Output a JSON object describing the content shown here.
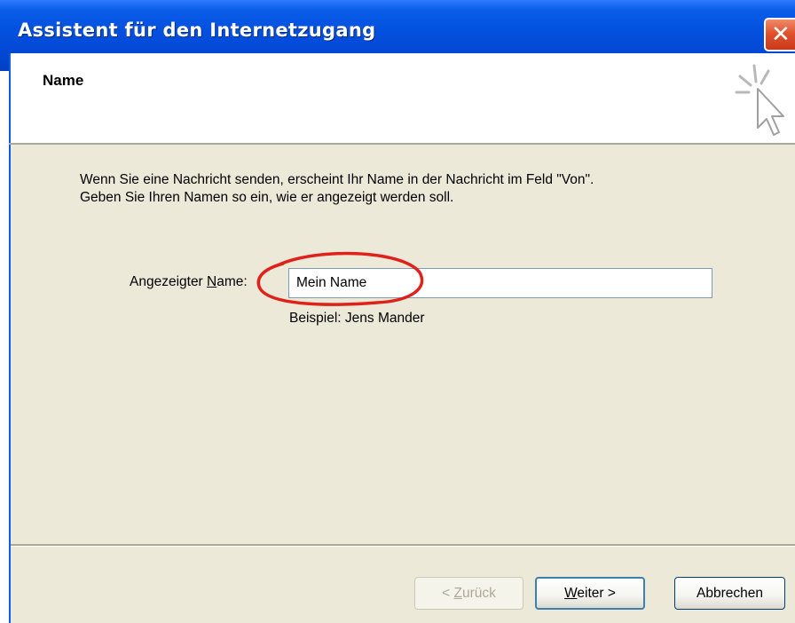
{
  "window": {
    "title": "Assistent für den Internetzugang",
    "close_icon": "close-icon"
  },
  "header": {
    "title": "Name",
    "icon": "wizard-cursor-icon"
  },
  "body": {
    "description_line1": "Wenn Sie eine Nachricht senden, erscheint Ihr Name in der Nachricht im Feld \"Von\".",
    "description_line2": "Geben Sie Ihren Namen so ein, wie er angezeigt werden soll.",
    "field_label_prefix": "Angezeigter ",
    "field_label_accel": "N",
    "field_label_suffix": "ame:",
    "name_value": "Mein Name",
    "example": "Beispiel: Jens Mander"
  },
  "buttons": {
    "back_prefix": "< ",
    "back_accel": "Z",
    "back_suffix": "urück",
    "next_accel": "W",
    "next_suffix": "eiter >",
    "cancel": "Abbrechen"
  },
  "colors": {
    "titlebar": "#0451e0",
    "body_background": "#ece9d8",
    "highlight_ellipse": "#e0201a",
    "close_button": "#e0532e"
  }
}
